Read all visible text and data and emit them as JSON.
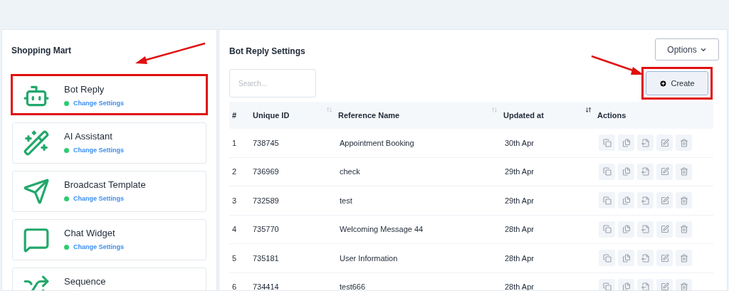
{
  "sidebar": {
    "title": "Shopping Mart",
    "items": [
      {
        "kind": "robot",
        "title": "Bot Reply",
        "link": "Change Settings",
        "active": true,
        "highlighted": true
      },
      {
        "kind": "wand",
        "title": "AI Assistant",
        "link": "Change Settings",
        "active": true,
        "highlighted": false
      },
      {
        "kind": "plane",
        "title": "Broadcast Template",
        "link": "Change Settings",
        "active": true,
        "highlighted": false
      },
      {
        "kind": "chat",
        "title": "Chat Widget",
        "link": "Change Settings",
        "active": true,
        "highlighted": false
      },
      {
        "kind": "sequence",
        "title": "Sequence",
        "highlighted": false
      }
    ]
  },
  "main": {
    "title": "Bot Reply Settings",
    "options_button": "Options",
    "search": {
      "placeholder": "Search..."
    },
    "create_button": {
      "label": "Create",
      "highlighted": true
    },
    "table": {
      "columns": [
        {
          "label": "#"
        },
        {
          "label": "Unique ID",
          "sorted": false
        },
        {
          "label": "Reference Name",
          "sorted": false
        },
        {
          "label": "Updated at",
          "sorted": true
        },
        {
          "label": "Actions"
        }
      ],
      "rows": [
        {
          "num": "1",
          "id": "738745",
          "name": "Appointment Booking",
          "updated": "30th Apr"
        },
        {
          "num": "2",
          "id": "736969",
          "name": "check",
          "updated": "29th Apr"
        },
        {
          "num": "3",
          "id": "732589",
          "name": "test",
          "updated": "29th Apr"
        },
        {
          "num": "4",
          "id": "735770",
          "name": "Welcoming Message 44",
          "updated": "28th Apr"
        },
        {
          "num": "5",
          "id": "735181",
          "name": "User Information",
          "updated": "28th Apr"
        },
        {
          "num": "6",
          "id": "734414",
          "name": "test666",
          "updated": "28th Apr"
        }
      ]
    }
  }
}
